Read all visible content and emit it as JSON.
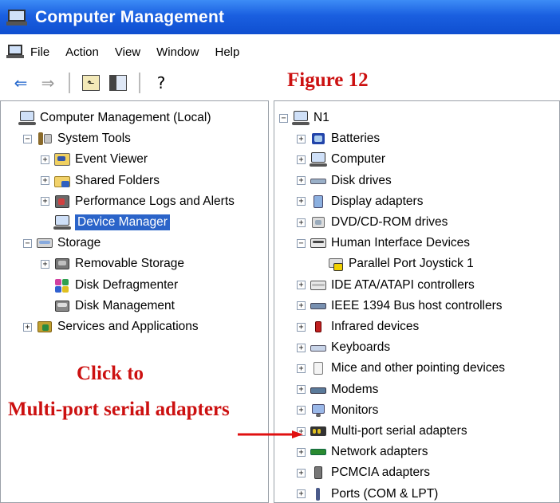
{
  "window": {
    "title": "Computer Management"
  },
  "menu": [
    "File",
    "Action",
    "View",
    "Window",
    "Help"
  ],
  "figure_label": "Figure 12",
  "left_tree": [
    {
      "label": "Computer Management (Local)",
      "icon": "computer-icon",
      "exp": "",
      "level": 0
    },
    {
      "label": "System Tools",
      "icon": "tools-icon",
      "exp": "−",
      "level": 1
    },
    {
      "label": "Event Viewer",
      "icon": "event-viewer-icon",
      "exp": "+",
      "level": 2
    },
    {
      "label": "Shared Folders",
      "icon": "shared-folder-icon",
      "exp": "+",
      "level": 2
    },
    {
      "label": "Performance Logs and Alerts",
      "icon": "performance-icon",
      "exp": "+",
      "level": 2
    },
    {
      "label": "Device Manager",
      "icon": "device-manager-icon",
      "exp": "",
      "level": 2,
      "selected": true
    },
    {
      "label": "Storage",
      "icon": "storage-icon",
      "exp": "−",
      "level": 1
    },
    {
      "label": "Removable Storage",
      "icon": "removable-storage-icon",
      "exp": "+",
      "level": 2
    },
    {
      "label": "Disk Defragmenter",
      "icon": "defrag-icon",
      "exp": "",
      "level": 2
    },
    {
      "label": "Disk Management",
      "icon": "disk-management-icon",
      "exp": "",
      "level": 2
    },
    {
      "label": "Services and Applications",
      "icon": "services-icon",
      "exp": "+",
      "level": 1
    }
  ],
  "right_tree": [
    {
      "label": "N1",
      "icon": "computer-icon",
      "exp": "−",
      "level": 0
    },
    {
      "label": "Batteries",
      "icon": "battery-icon",
      "exp": "+",
      "level": 1
    },
    {
      "label": "Computer",
      "icon": "computer-icon",
      "exp": "+",
      "level": 1
    },
    {
      "label": "Disk drives",
      "icon": "disk-drive-icon",
      "exp": "+",
      "level": 1
    },
    {
      "label": "Display adapters",
      "icon": "display-adapter-icon",
      "exp": "+",
      "level": 1
    },
    {
      "label": "DVD/CD-ROM drives",
      "icon": "cdrom-icon",
      "exp": "+",
      "level": 1
    },
    {
      "label": "Human Interface Devices",
      "icon": "hid-icon",
      "exp": "−",
      "level": 1
    },
    {
      "label": "Parallel Port Joystick 1",
      "icon": "warning-device-icon",
      "exp": "",
      "level": 2
    },
    {
      "label": "IDE ATA/ATAPI controllers",
      "icon": "ide-controller-icon",
      "exp": "+",
      "level": 1
    },
    {
      "label": "IEEE 1394 Bus host controllers",
      "icon": "ieee1394-icon",
      "exp": "+",
      "level": 1
    },
    {
      "label": "Infrared devices",
      "icon": "infrared-icon",
      "exp": "+",
      "level": 1
    },
    {
      "label": "Keyboards",
      "icon": "keyboard-icon",
      "exp": "+",
      "level": 1
    },
    {
      "label": "Mice and other pointing devices",
      "icon": "mouse-icon",
      "exp": "+",
      "level": 1
    },
    {
      "label": "Modems",
      "icon": "modem-icon",
      "exp": "+",
      "level": 1
    },
    {
      "label": "Monitors",
      "icon": "monitor-icon",
      "exp": "+",
      "level": 1
    },
    {
      "label": "Multi-port serial adapters",
      "icon": "serial-adapter-icon",
      "exp": "+",
      "level": 1
    },
    {
      "label": "Network adapters",
      "icon": "network-adapter-icon",
      "exp": "+",
      "level": 1
    },
    {
      "label": "PCMCIA adapters",
      "icon": "pcmcia-icon",
      "exp": "+",
      "level": 1
    },
    {
      "label": "Ports (COM & LPT)",
      "icon": "ports-icon",
      "exp": "+",
      "level": 1
    }
  ],
  "annotation": {
    "line1": "Click to",
    "line2": "Multi-port serial adapters"
  },
  "colors": {
    "title_bar": "#1a5fe0",
    "selection": "#2b64c9",
    "annotation": "#cc1010"
  }
}
